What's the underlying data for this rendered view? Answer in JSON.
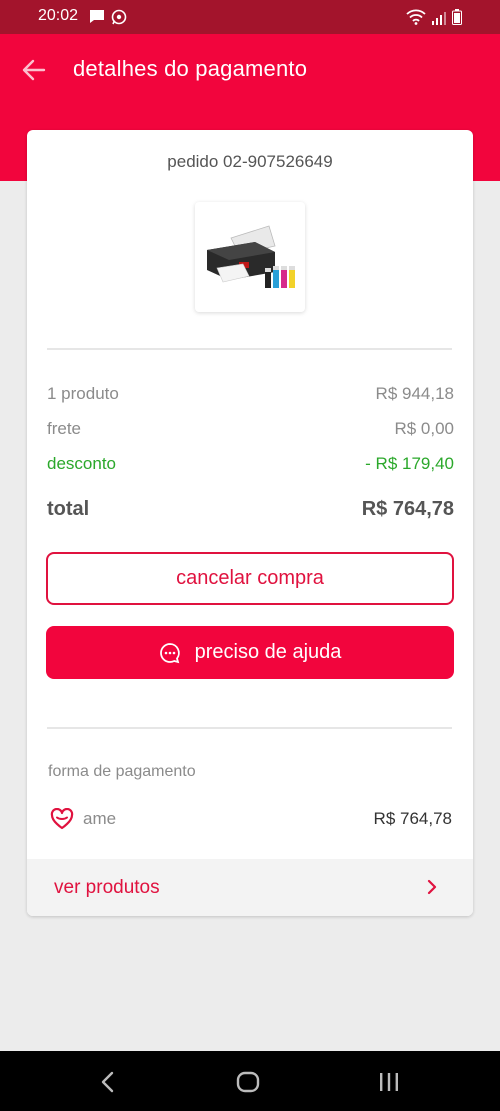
{
  "status_bar": {
    "time": "20:02"
  },
  "header": {
    "title": "detalhes do pagamento"
  },
  "order": {
    "id_label": "pedido 02-907526649"
  },
  "summary": {
    "products_label": "1 produto",
    "products_value": "R$ 944,18",
    "shipping_label": "frete",
    "shipping_value": "R$ 0,00",
    "discount_label": "desconto",
    "discount_value": "- R$ 179,40",
    "total_label": "total",
    "total_value": "R$ 764,78"
  },
  "actions": {
    "cancel_label": "cancelar compra",
    "help_label": "preciso de ajuda"
  },
  "payment": {
    "section_label": "forma de pagamento",
    "method_name": "ame",
    "method_amount": "R$ 764,78"
  },
  "footer_link": {
    "label": "ver produtos"
  },
  "colors": {
    "primary": "#f2053d",
    "status_bar": "#a3142c",
    "discount": "#2ba82b",
    "background": "#ececec"
  },
  "icons": {
    "back": "arrow-left-icon",
    "help": "chat-bubble-icon",
    "payment_method": "heart-icon",
    "footer": "chevron-right-icon"
  }
}
